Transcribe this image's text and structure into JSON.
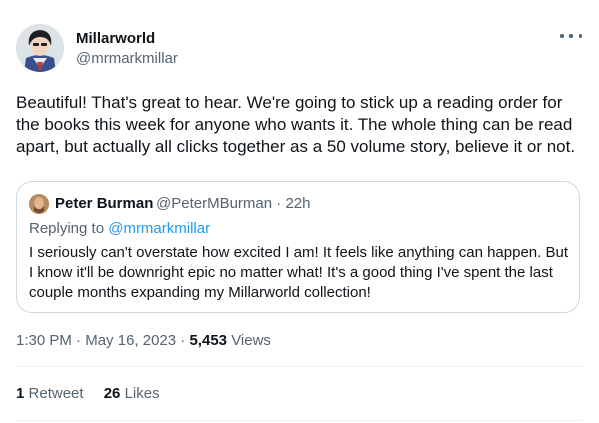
{
  "tweet": {
    "author_name": "Millarworld",
    "author_handle": "@mrmarkmillar",
    "text": "Beautiful! That's great to hear. We're going to stick up a reading order for the books this week for anyone who wants it. The whole thing can be read apart, but actually all clicks together as a 50 volume story, believe it or not.",
    "more_icon": "more-horizontal-icon"
  },
  "quote": {
    "author_name": "Peter Burman",
    "author_handle": "@PeterMBurman",
    "separator": "·",
    "time": "22h",
    "replying_prefix": "Replying to",
    "replying_handle": "@mrmarkmillar",
    "text": "I seriously can't overstate how excited I am! It feels like anything can happen. But I know it'll be downright epic no matter what! It's a good thing I've spent the last couple months expanding my Millarworld collection!"
  },
  "meta": {
    "time": "1:30 PM",
    "sep1": "·",
    "date": "May 16, 2023",
    "sep2": "·",
    "views_count": "5,453",
    "views_label": "Views"
  },
  "stats": {
    "retweets_count": "1",
    "retweets_label": "Retweet",
    "likes_count": "26",
    "likes_label": "Likes"
  },
  "colors": {
    "text_primary": "#0f1419",
    "text_secondary": "#536471",
    "link": "#1d9bf0",
    "border": "#cfd9de"
  }
}
